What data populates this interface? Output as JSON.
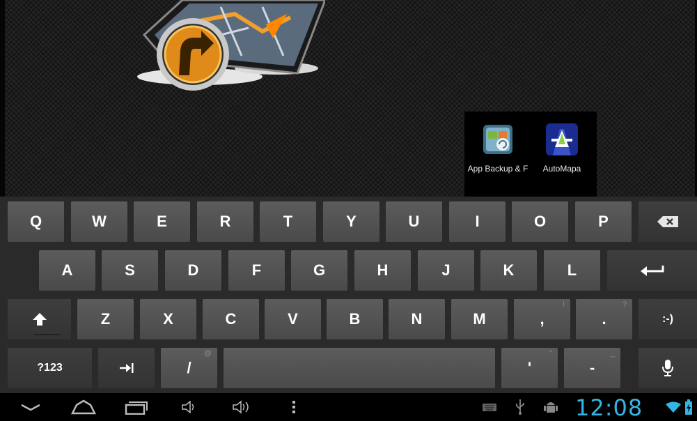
{
  "folder": {
    "apps": [
      {
        "label": "App Backup & F",
        "icon": "app-backup-icon"
      },
      {
        "label": "AutoMapa",
        "icon": "automapa-icon"
      }
    ]
  },
  "keyboard": {
    "row1": [
      "Q",
      "W",
      "E",
      "R",
      "T",
      "Y",
      "U",
      "I",
      "O",
      "P"
    ],
    "row2": [
      "A",
      "S",
      "D",
      "F",
      "G",
      "H",
      "J",
      "K",
      "L"
    ],
    "row3": [
      "Z",
      "X",
      "C",
      "V",
      "B",
      "N",
      "M"
    ],
    "comma": {
      "label": ",",
      "hint": "!"
    },
    "period": {
      "label": ".",
      "hint": "?"
    },
    "smiley": ":-)",
    "sym": "?123",
    "slash": {
      "label": "/",
      "hint": "@"
    },
    "apostrophe": {
      "label": "'",
      "hint": "\""
    },
    "dash": {
      "label": "-",
      "hint": "_"
    },
    "icons": {
      "backspace": "backspace-icon",
      "enter": "enter-icon",
      "shift": "shift-icon",
      "tab": "tab-icon",
      "mic": "microphone-icon"
    }
  },
  "statusbar": {
    "time": "12:08",
    "accent": "#33b5e5",
    "icons": [
      "back-icon",
      "home-icon",
      "recent-apps-icon",
      "volume-down-icon",
      "volume-up-icon",
      "menu-icon",
      "keyboard-icon",
      "usb-icon",
      "android-debug-icon",
      "wifi-icon",
      "battery-icon"
    ]
  }
}
